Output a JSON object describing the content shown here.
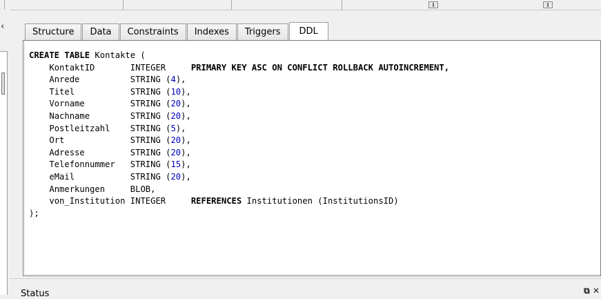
{
  "tabs": [
    {
      "label": "Structure"
    },
    {
      "label": "Data"
    },
    {
      "label": "Constraints"
    },
    {
      "label": "Indexes"
    },
    {
      "label": "Triggers"
    },
    {
      "label": "DDL"
    }
  ],
  "active_tab": "DDL",
  "ddl": {
    "header": {
      "keyword": "CREATE TABLE",
      "name": " Kontakte ("
    },
    "columns": [
      {
        "name": "KontaktID",
        "type": "INTEGER",
        "rest": "",
        "constraint": "PRIMARY KEY ASC ON CONFLICT ROLLBACK AUTOINCREMENT,"
      },
      {
        "name": "Anrede",
        "type": "STRING",
        "size": "4"
      },
      {
        "name": "Titel",
        "type": "STRING",
        "size": "10"
      },
      {
        "name": "Vorname",
        "type": "STRING",
        "size": "20"
      },
      {
        "name": "Nachname",
        "type": "STRING",
        "size": "20"
      },
      {
        "name": "Postleitzahl",
        "type": "STRING",
        "size": "5"
      },
      {
        "name": "Ort",
        "type": "STRING",
        "size": "20"
      },
      {
        "name": "Adresse",
        "type": "STRING",
        "size": "20"
      },
      {
        "name": "Telefonnummer",
        "type": "STRING",
        "size": "15"
      },
      {
        "name": "eMail",
        "type": "STRING",
        "size": "20"
      },
      {
        "name": "Anmerkungen",
        "type": "BLOB,"
      },
      {
        "name": "von_Institution",
        "type": "INTEGER",
        "ref_keyword": "REFERENCES",
        "ref_target": " Institutionen (InstitutionsID)"
      }
    ],
    "closing": ");"
  },
  "status": {
    "title": "Status",
    "float_icon": "float-icon",
    "close_icon": "close-icon"
  }
}
